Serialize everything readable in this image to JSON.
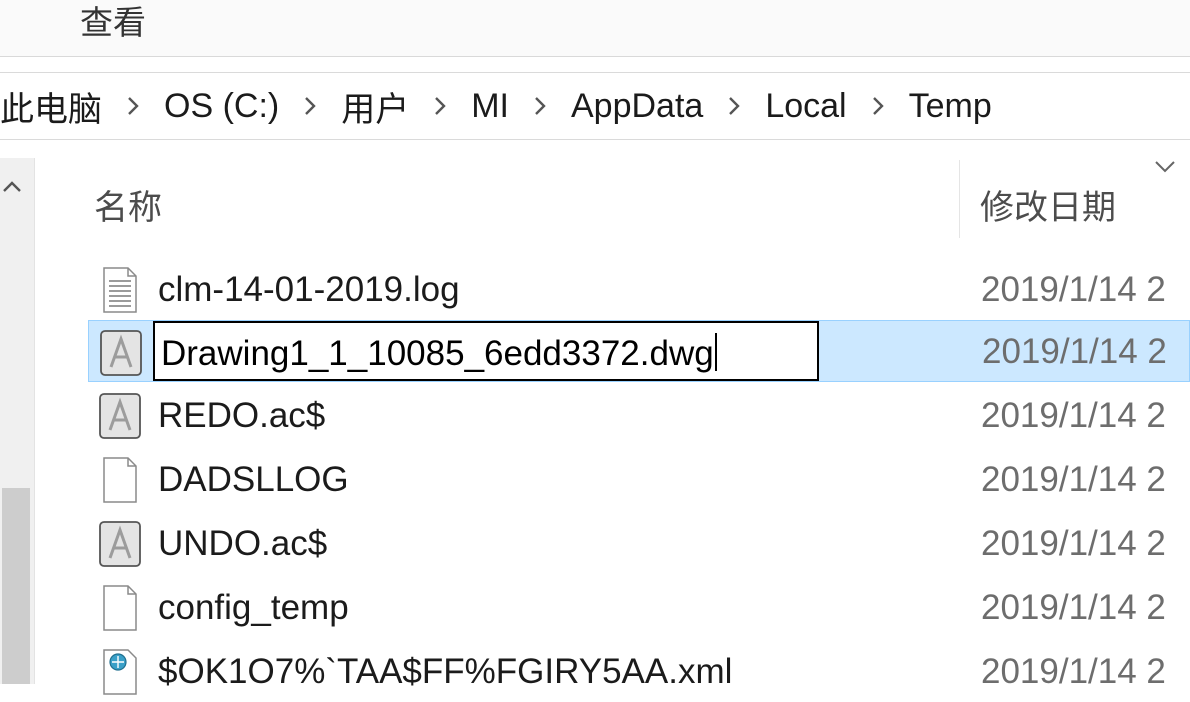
{
  "ribbon": {
    "tab_view": "查看"
  },
  "breadcrumb": [
    "此电脑",
    "OS (C:)",
    "用户",
    "MI",
    "AppData",
    "Local",
    "Temp"
  ],
  "columns": {
    "name": "名称",
    "date_modified": "修改日期"
  },
  "files": [
    {
      "name": "clm-14-01-2019.log",
      "date": "2019/1/14 2",
      "icon": "text-document-icon"
    },
    {
      "name": "Drawing1_1_10085_6edd3372.dwg",
      "date": "2019/1/14 2",
      "icon": "autocad-file-icon",
      "selected": true,
      "renaming": true
    },
    {
      "name": "REDO.ac$",
      "date": "2019/1/14 2",
      "icon": "autocad-file-icon"
    },
    {
      "name": "DADSLLOG",
      "date": "2019/1/14 2",
      "icon": "blank-file-icon"
    },
    {
      "name": "UNDO.ac$",
      "date": "2019/1/14 2",
      "icon": "autocad-file-icon"
    },
    {
      "name": "config_temp",
      "date": "2019/1/14 2",
      "icon": "blank-file-icon"
    },
    {
      "name": "$OK1O7%`TAA$FF%FGIRY5AA.xml",
      "date": "2019/1/14 2",
      "icon": "xml-file-icon"
    }
  ],
  "colors": {
    "selection_bg": "#cce8ff",
    "selection_border": "#99d1ff"
  }
}
